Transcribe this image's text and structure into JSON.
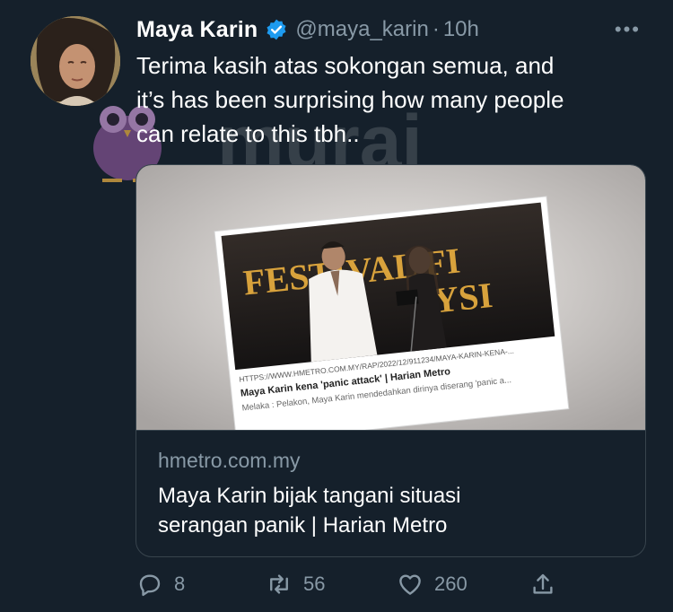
{
  "tweet": {
    "author_name": "Maya Karin",
    "handle": "@maya_karin",
    "separator": "·",
    "time": "10h",
    "more_label": "•••",
    "text_line1": "Terima kasih atas sokongan semua, and",
    "text_line2": "it’s has been surprising how many people",
    "text_line3": "can relate to this tbh.."
  },
  "watermark": {
    "text": "murai"
  },
  "card": {
    "image": {
      "banner_line1": "FESTIVAL FI",
      "banner_line2": "YSI",
      "url": "HTTPS://WWW.HMETRO.COM.MY/RAP/2022/12/911234/MAYA-KARIN-KENA-...",
      "headline": "Maya Karin kena 'panic attack' | Harian Metro",
      "snippet": "Melaka : Pelakon, Maya Karin mendedahkan dirinya diserang 'panic a..."
    },
    "domain": "hmetro.com.my",
    "title_line1": "Maya Karin bijak tangani situasi",
    "title_line2": "serangan panik | Harian Metro"
  },
  "actions": {
    "replies": "8",
    "retweets": "56",
    "likes": "260"
  },
  "colors": {
    "background": "#15202b",
    "secondary_text": "#8899a6",
    "verified_blue": "#1d9bf0",
    "border": "#38444d"
  }
}
